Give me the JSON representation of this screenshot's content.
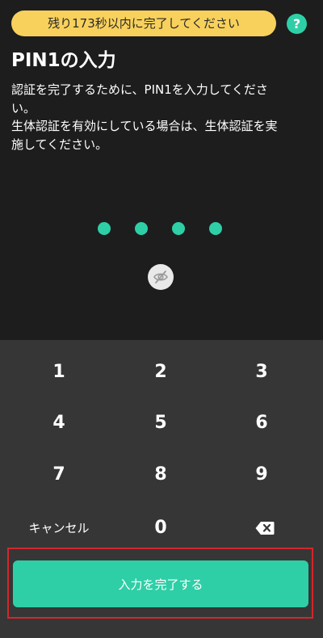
{
  "header": {
    "timer_text": "残り173秒以内に完了してください",
    "help_label": "?"
  },
  "content": {
    "title": "PIN1の入力",
    "description_lines": [
      "認証を完了するために、PIN1を入力してくださ",
      "い。",
      "生体認証を有効にしている場合は、生体認証を実",
      "施してください。"
    ]
  },
  "pin": {
    "entered_count": 4,
    "visibility_icon": "eye-slash-icon"
  },
  "keypad": {
    "keys": [
      "1",
      "2",
      "3",
      "4",
      "5",
      "6",
      "7",
      "8",
      "9"
    ],
    "cancel_label": "キャンセル",
    "zero_label": "0",
    "backspace_icon": "backspace-icon"
  },
  "submit": {
    "label": "入力を完了する"
  },
  "colors": {
    "accent": "#2ecfa6",
    "timer_bg": "#f8d15c",
    "top_bg": "#1d1d1d",
    "keypad_bg": "#363636",
    "highlight_border": "#d3272b"
  }
}
